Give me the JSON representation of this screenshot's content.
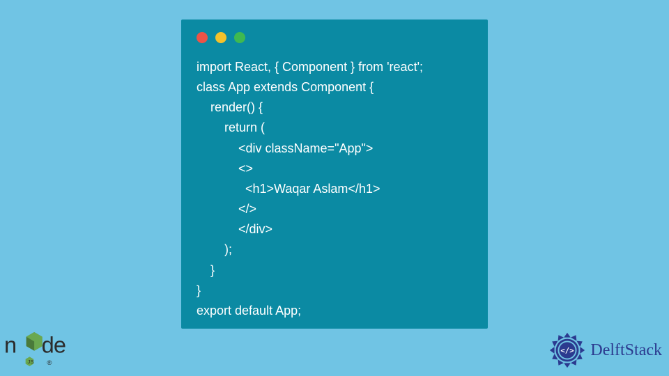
{
  "code": {
    "lines": [
      "import React, { Component } from 'react';",
      "class App extends Component {",
      "    render() {",
      "        return (",
      "            <div className=\"App\">",
      "            <>",
      "              <h1>Waqar Aslam</h1>",
      "            </>",
      "            </div>",
      "        );",
      "    }",
      "}",
      "export default App;"
    ]
  },
  "logos": {
    "node_label": "node",
    "delft_label": "DelftStack"
  },
  "colors": {
    "bg": "#70c4e4",
    "window": "#0b8aa3",
    "red": "#ec5347",
    "yellow": "#f4c22b",
    "green": "#3fb950",
    "delft_blue": "#2b3a8f"
  }
}
